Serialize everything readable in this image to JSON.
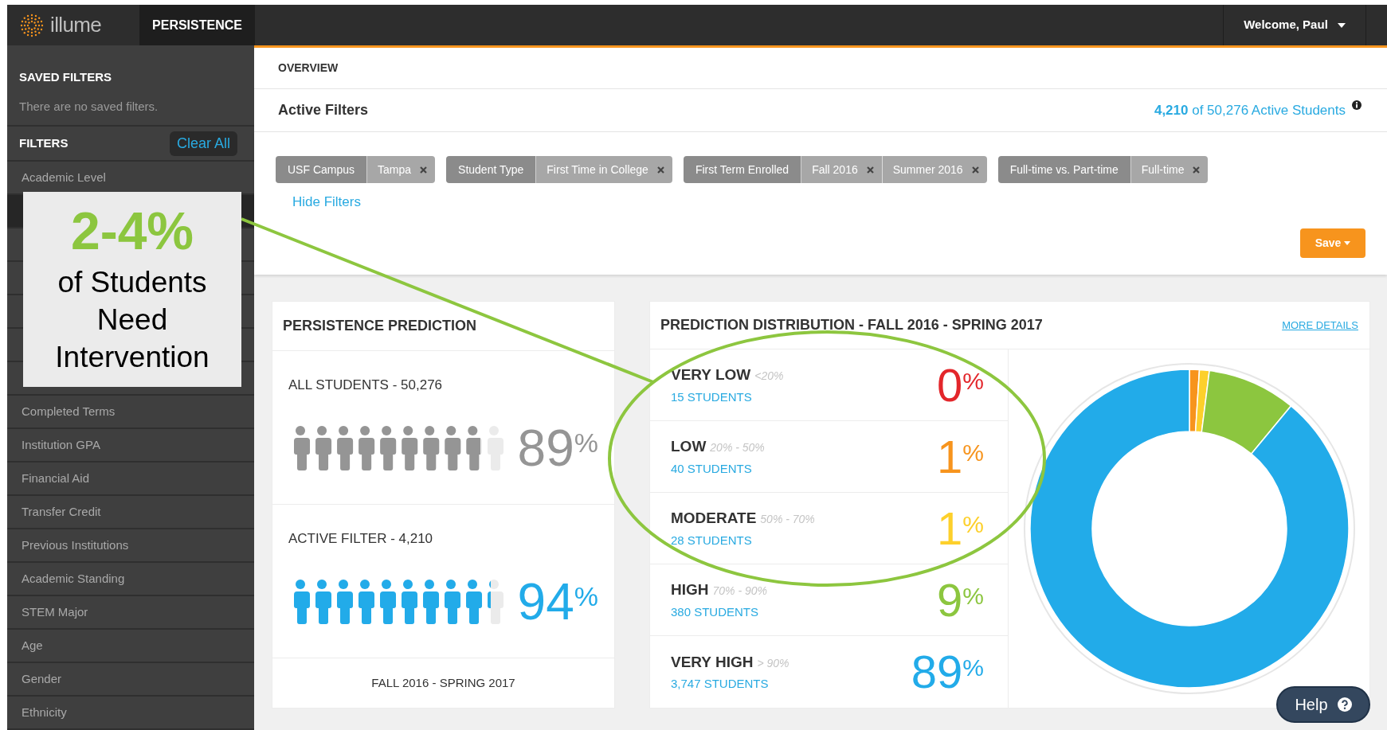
{
  "header": {
    "logo": "illume",
    "app_tab": "PERSISTENCE",
    "user_menu": "Welcome, Paul"
  },
  "sidebar": {
    "saved_title": "SAVED FILTERS",
    "saved_empty": "There are no saved filters.",
    "filters_title": "FILTERS",
    "clear_button": "Clear All",
    "items": [
      {
        "label": "Academic Level"
      },
      {
        "label": "Completed Terms"
      },
      {
        "label": "Institution GPA"
      },
      {
        "label": "Financial Aid"
      },
      {
        "label": "Transfer Credit"
      },
      {
        "label": "Previous Institutions"
      },
      {
        "label": "Academic Standing"
      },
      {
        "label": "STEM Major"
      },
      {
        "label": "Age"
      },
      {
        "label": "Gender"
      },
      {
        "label": "Ethnicity"
      }
    ]
  },
  "overview": {
    "title": "OVERVIEW",
    "active_filters_title": "Active Filters",
    "active_count": "**4,210** of 50,276 Active Students",
    "filters": [
      {
        "name": "USF Campus",
        "values": [
          "Tampa"
        ]
      },
      {
        "name": "Student Type",
        "values": [
          "First Time in College"
        ]
      },
      {
        "name": "First Term Enrolled",
        "values": [
          "Fall 2016",
          "Summer 2016"
        ]
      },
      {
        "name": "Full-time vs. Part-time",
        "values": [
          "Full-time"
        ]
      }
    ],
    "hide_link": "Hide Filters",
    "save_button": "Save"
  },
  "persistence": {
    "title": "PERSISTENCE PREDICTION",
    "groups": [
      {
        "label": "ALL STUDENTS - 50,276",
        "percent": "89$^{%}$",
        "level": 0.89,
        "color": "#959595"
      },
      {
        "label": "ACTIVE FILTER - 4,210",
        "percent": "94$^{%}$",
        "level": 0.94,
        "color": "#22abe9"
      }
    ],
    "footer": "FALL 2016 - SPRING 2017"
  },
  "distribution": {
    "title": "PREDICTION DISTRIBUTION - FALL 2016 - SPRING 2017",
    "more_link": "MORE DETAILS",
    "rows": [
      {
        "label": "VERY LOW",
        "range": "<20%",
        "students": "15 STUDENTS",
        "percent": "0$^{%}$",
        "color": "#e3262b"
      },
      {
        "label": "LOW",
        "range": "20% - 50%",
        "students": "40 STUDENTS",
        "percent": "1$^{%}$",
        "color": "#f7941d"
      },
      {
        "label": "MODERATE",
        "range": "50% - 70%",
        "students": "28 STUDENTS",
        "percent": "1$^{%}$",
        "color": "#fdd02b"
      },
      {
        "label": "HIGH",
        "range": "70% - 90%",
        "students": "380 STUDENTS",
        "percent": "9$^{%}$",
        "color": "#8cc63f"
      },
      {
        "label": "VERY HIGH",
        "range": "> 90%",
        "students": "3,747 STUDENTS",
        "percent": "89$^{%}$",
        "color": "#22abe9"
      }
    ],
    "chart_data": {
      "type": "donut",
      "values": [
        0,
        1,
        1,
        9,
        89
      ]
    }
  },
  "help_button": "Help",
  "callout": {
    "headline": "2-4%",
    "text": "of Students Need Intervention"
  }
}
